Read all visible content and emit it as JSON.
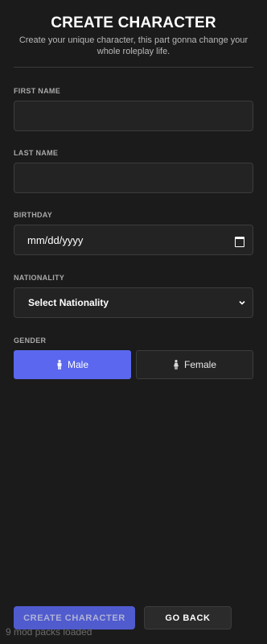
{
  "header": {
    "title": "CREATE CHARACTER",
    "subtitle": "Create your unique character, this part gonna change your whole roleplay life."
  },
  "fields": {
    "first_name": {
      "label": "FIRST NAME",
      "value": ""
    },
    "last_name": {
      "label": "LAST NAME",
      "value": ""
    },
    "birthday": {
      "label": "BIRTHDAY",
      "value": "mm/dd/yyyy"
    },
    "nationality": {
      "label": "NATIONALITY",
      "selected": "Select Nationality"
    }
  },
  "gender": {
    "label": "GENDER",
    "options": [
      {
        "label": "Male",
        "icon": "male-icon",
        "selected": true
      },
      {
        "label": "Female",
        "icon": "female-icon",
        "selected": false
      }
    ]
  },
  "footer": {
    "create_label": "CREATE CHARACTER",
    "back_label": "GO BACK"
  },
  "status_text": "9 mod packs loaded",
  "colors": {
    "accent": "#5a67ee",
    "background": "#1b1b1b",
    "field_bg": "#232323"
  }
}
